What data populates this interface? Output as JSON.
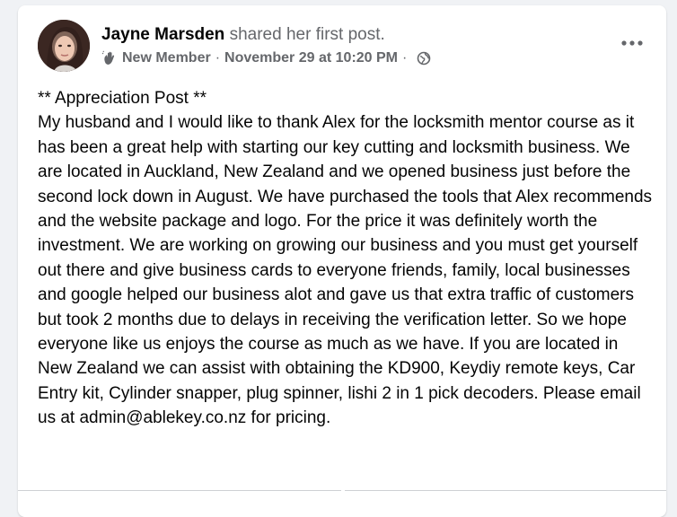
{
  "post": {
    "author_name": "Jayne Marsden",
    "author_action": "shared her first post.",
    "badge": "New Member",
    "timestamp": "November 29 at 10:20 PM",
    "separator": "·",
    "audience_icon": "globe-icon",
    "badge_icon": "wave-hand-icon",
    "more_icon": "more-options-icon",
    "text": "** Appreciation Post **\nMy husband and I would like to thank Alex for the locksmith mentor course as it has been a great help with starting our key cutting and locksmith business. We are located in Auckland, New Zealand and we opened business just before the second lock down in August. We have purchased the tools that Alex recommends and the website package and logo. For the price it was definitely worth the investment. We are working on growing our business and you must get yourself out there and give business cards to everyone friends, family, local businesses and google helped our business alot and gave us that extra traffic of customers but took 2 months due to delays in receiving the verification letter. So we hope everyone like us enjoys the course as much as we have. If you are located in New Zealand we can assist with obtaining the KD900, Keydiy remote keys, Car Entry kit, Cylinder snapper, plug spinner, lishi 2 in 1 pick decoders. Please email us at admin@ablekey.co.nz for pricing."
  },
  "colors": {
    "background": "#f0f2f5",
    "card": "#ffffff",
    "primary_text": "#050505",
    "secondary_text": "#65676b"
  }
}
